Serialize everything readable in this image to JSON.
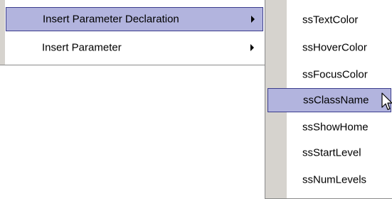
{
  "parent_menu": {
    "items": [
      {
        "label": "Insert Parameter Declaration",
        "has_submenu": true,
        "highlighted": true
      },
      {
        "label": "Insert Parameter",
        "has_submenu": true,
        "highlighted": false
      }
    ]
  },
  "submenu": {
    "items": [
      {
        "label": "ssTextColor"
      },
      {
        "label": "ssHoverColor"
      },
      {
        "label": "ssFocusColor"
      },
      {
        "label": "ssClassName",
        "highlighted": true
      },
      {
        "label": "ssShowHome"
      },
      {
        "label": "ssStartLevel"
      },
      {
        "label": "ssNumLevels"
      }
    ]
  },
  "colors": {
    "highlight_fill": "#b2b4de",
    "highlight_border": "#3a3c8c",
    "gutter": "#d6d3ce"
  },
  "icons": [
    "submenu-arrow-icon",
    "mouse-pointer-icon"
  ]
}
